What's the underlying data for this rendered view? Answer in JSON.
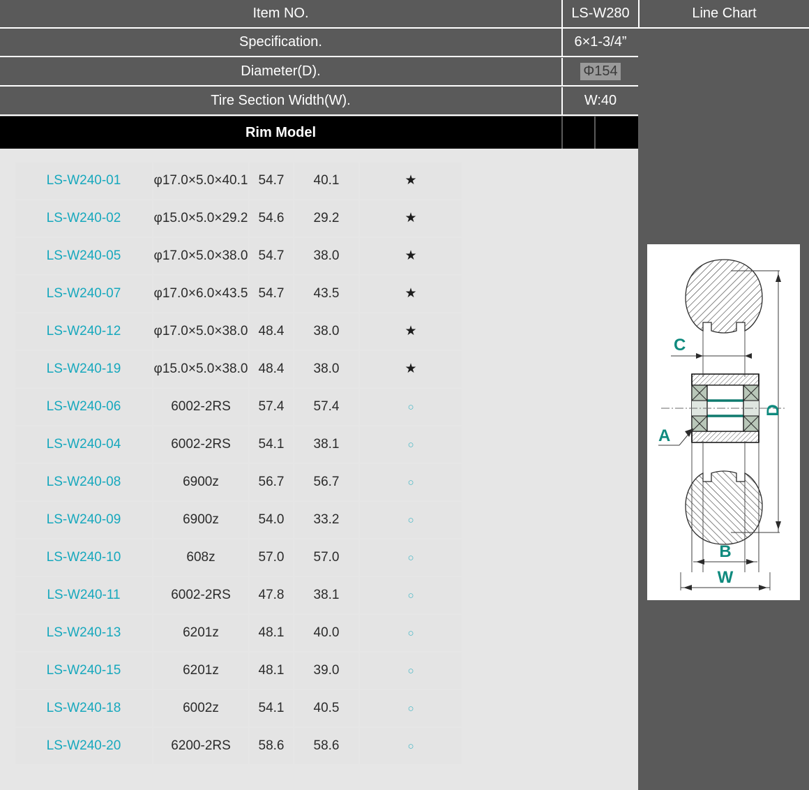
{
  "header": {
    "rows": [
      {
        "label": "Item NO.",
        "value": "LS-W280",
        "highlight": false
      },
      {
        "label": "Specification.",
        "value": "6×1-3/4”",
        "highlight": false
      },
      {
        "label": "Diameter(D).",
        "value": "Φ154",
        "highlight": true
      },
      {
        "label": "Tire Section Width(W).",
        "value": "W:40",
        "highlight": false
      }
    ],
    "chart_title": "Line Chart",
    "section_title": "Rim Model"
  },
  "colors": {
    "header_bg": "#5a5a5a",
    "band_bg": "#000000",
    "table_bg": "#e6e6e6",
    "cell_bg": "#e4e4e4",
    "model_link": "#17a8bd",
    "circle_mark": "#3fb5c4",
    "star_mark": "#1d1d1d",
    "drawing_accent": "#0f8a7e",
    "highlight_bg": "#9a9a9a"
  },
  "table": {
    "columns": [
      "model",
      "spec",
      "value1",
      "value2",
      "mark"
    ],
    "rows": [
      {
        "model": "LS-W240-01",
        "spec": "φ17.0×5.0×40.1",
        "value1": "54.7",
        "value2": "40.1",
        "mark": "★"
      },
      {
        "model": "LS-W240-02",
        "spec": "φ15.0×5.0×29.2",
        "value1": "54.6",
        "value2": "29.2",
        "mark": "★"
      },
      {
        "model": "LS-W240-05",
        "spec": "φ17.0×5.0×38.0",
        "value1": "54.7",
        "value2": "38.0",
        "mark": "★"
      },
      {
        "model": "LS-W240-07",
        "spec": "φ17.0×6.0×43.5",
        "value1": "54.7",
        "value2": "43.5",
        "mark": "★"
      },
      {
        "model": "LS-W240-12",
        "spec": "φ17.0×5.0×38.0",
        "value1": "48.4",
        "value2": "38.0",
        "mark": "★"
      },
      {
        "model": "LS-W240-19",
        "spec": "φ15.0×5.0×38.0",
        "value1": "48.4",
        "value2": "38.0",
        "mark": "★"
      },
      {
        "model": "LS-W240-06",
        "spec": "6002-2RS",
        "value1": "57.4",
        "value2": "57.4",
        "mark": "○"
      },
      {
        "model": "LS-W240-04",
        "spec": "6002-2RS",
        "value1": "54.1",
        "value2": "38.1",
        "mark": "○"
      },
      {
        "model": "LS-W240-08",
        "spec": "6900z",
        "value1": "56.7",
        "value2": "56.7",
        "mark": "○"
      },
      {
        "model": "LS-W240-09",
        "spec": "6900z",
        "value1": "54.0",
        "value2": "33.2",
        "mark": "○"
      },
      {
        "model": "LS-W240-10",
        "spec": "608z",
        "value1": "57.0",
        "value2": "57.0",
        "mark": "○"
      },
      {
        "model": "LS-W240-11",
        "spec": "6002-2RS",
        "value1": "47.8",
        "value2": "38.1",
        "mark": "○"
      },
      {
        "model": "LS-W240-13",
        "spec": "6201z",
        "value1": "48.1",
        "value2": "40.0",
        "mark": "○"
      },
      {
        "model": "LS-W240-15",
        "spec": "6201z",
        "value1": "48.1",
        "value2": "39.0",
        "mark": "○"
      },
      {
        "model": "LS-W240-18",
        "spec": "6002z",
        "value1": "54.1",
        "value2": "40.5",
        "mark": "○"
      },
      {
        "model": "LS-W240-20",
        "spec": "6200-2RS",
        "value1": "58.6",
        "value2": "58.6",
        "mark": "○"
      }
    ]
  },
  "drawing": {
    "labels": {
      "a": "A",
      "b": "B",
      "c": "C",
      "d": "D",
      "w": "W"
    }
  }
}
